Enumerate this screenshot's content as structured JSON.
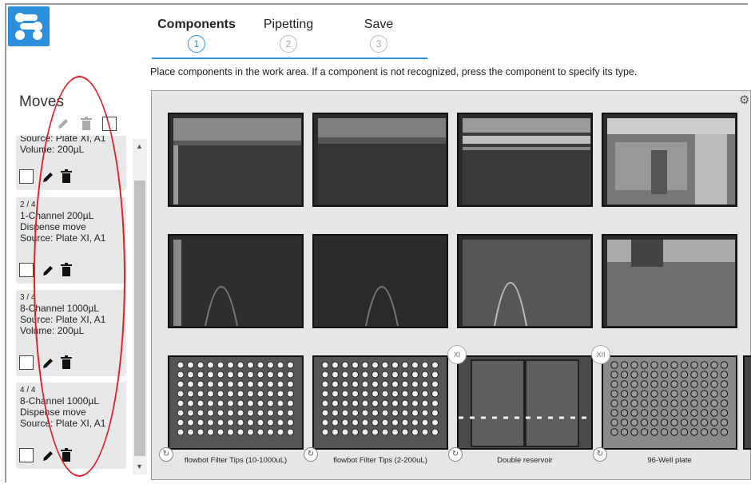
{
  "wizard": {
    "steps": [
      {
        "label": "Components",
        "number": "1",
        "active": true
      },
      {
        "label": "Pipetting",
        "number": "2",
        "active": false
      },
      {
        "label": "Save",
        "number": "3",
        "active": false
      }
    ],
    "instruction": "Place components in the work area. If a component is not recognized, press the component to specify its type."
  },
  "moves": {
    "title": "Moves",
    "cards": [
      {
        "index": "",
        "lines": [
          "Source: Plate XI, A1",
          "Volume: 200µL"
        ]
      },
      {
        "index": "2 / 4",
        "lines": [
          "1-Channel 200µL",
          "Dispense move",
          "Source: Plate XI, A1"
        ]
      },
      {
        "index": "3 / 4",
        "lines": [
          "8-Channel 1000µL",
          "Source: Plate XI, A1",
          "Volume: 200µL"
        ]
      },
      {
        "index": "4 / 4",
        "lines": [
          "8-Channel 1000µL",
          "Dispense move",
          "Source: Plate XI, A1"
        ]
      }
    ]
  },
  "work_area": {
    "components": [
      {
        "label": "flowbot Filter Tips (10-1000uL)",
        "slot": ""
      },
      {
        "label": "flowbot Filter Tips (2-200uL)",
        "slot": ""
      },
      {
        "label": "Double reservoir",
        "slot": "XI"
      },
      {
        "label": "96-Well plate",
        "slot": "XII"
      }
    ]
  },
  "colors": {
    "accent": "#2b8fdc",
    "annotation": "#e21e26"
  }
}
